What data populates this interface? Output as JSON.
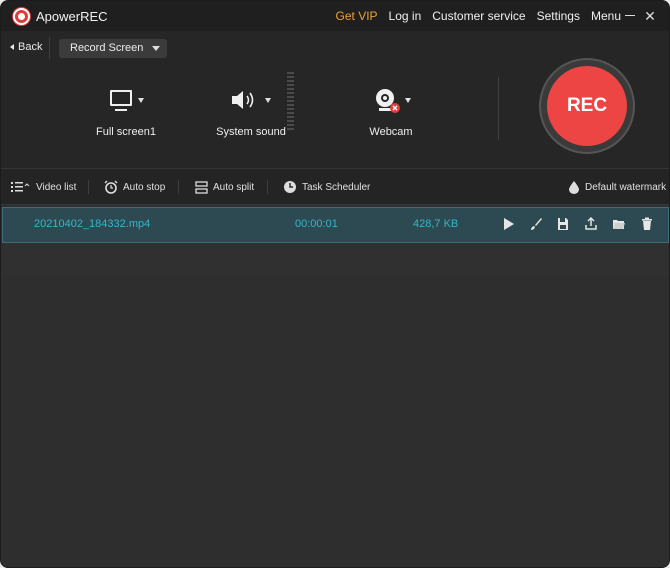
{
  "titlebar": {
    "app_name": "ApowerREC",
    "menu": {
      "get_vip": "Get VIP",
      "log_in": "Log in",
      "customer_service": "Customer service",
      "settings": "Settings",
      "menu": "Menu"
    },
    "close_glyph": "✕"
  },
  "nav": {
    "back_label": "Back",
    "mode": "Record Screen"
  },
  "controls": {
    "screen_label": "Full screen1",
    "sound_label": "System sound",
    "webcam_label": "Webcam",
    "rec_label": "REC"
  },
  "toolbar": {
    "video_list": "Video list",
    "auto_stop": "Auto stop",
    "auto_split": "Auto split",
    "task_scheduler": "Task Scheduler",
    "watermark": "Default watermark"
  },
  "files": [
    {
      "name": "20210402_184332.mp4",
      "duration": "00:00:01",
      "size": "428,7 KB"
    }
  ],
  "colors": {
    "accent_rec": "#ed4444",
    "vip": "#f0a030",
    "file_text": "#33b7c8",
    "row_selected": "#2d4a52"
  },
  "icons": [
    "monitor-icon",
    "speaker-icon",
    "webcam-icon",
    "list-icon",
    "alarm-clock-icon",
    "split-icon",
    "clock-icon",
    "droplet-icon",
    "play-icon",
    "edit-brush-icon",
    "save-icon",
    "upload-icon",
    "folder-icon",
    "trash-icon"
  ]
}
